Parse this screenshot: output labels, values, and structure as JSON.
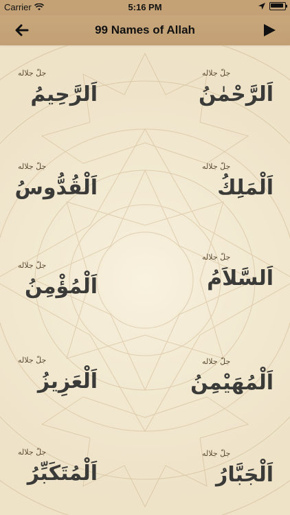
{
  "status_bar": {
    "carrier": "Carrier",
    "time": "5:16 PM"
  },
  "nav": {
    "title": "99 Names of Allah"
  },
  "names": [
    {
      "arabic": "اَلرَّحْمٰنُ",
      "honorific": "جلّ جلاله"
    },
    {
      "arabic": "اَلرَّحِيمُ",
      "honorific": "جلّ جلاله"
    },
    {
      "arabic": "اَلْمَلِكُ",
      "honorific": "جلّ جلاله"
    },
    {
      "arabic": "اَلْقُدُّوسُ",
      "honorific": "جلّ جلاله"
    },
    {
      "arabic": "اَلسَّلاَمُ",
      "honorific": "جلّ جلاله"
    },
    {
      "arabic": "اَلْمُؤْمِنُ",
      "honorific": "جلّ جلاله"
    },
    {
      "arabic": "اَلْمُهَيْمِنُ",
      "honorific": "جلّ جلاله"
    },
    {
      "arabic": "اَلْعَزِيزُ",
      "honorific": "جلّ جلاله"
    },
    {
      "arabic": "اَلْجَبَّارُ",
      "honorific": "جلّ جلاله"
    },
    {
      "arabic": "اَلْمُتَكَبِّرُ",
      "honorific": "جلّ جلاله"
    }
  ],
  "colors": {
    "nav_background": "#c4a276",
    "content_background": "#f3ead4",
    "text": "#3a3a38"
  }
}
